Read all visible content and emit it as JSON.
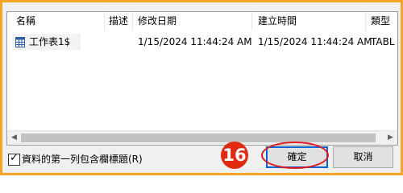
{
  "columns": [
    "名稱",
    "描述",
    "修改日期",
    "建立時間",
    "類型"
  ],
  "rows": [
    {
      "icon": "table-icon",
      "name": "工作表1$",
      "description": "",
      "modified": "1/15/2024 11:44:24 AM",
      "created": "1/15/2024 11:44:24 AM",
      "type": "TABL"
    }
  ],
  "checkbox": {
    "label": "資料的第一列包含欄標題(R)",
    "checked": true
  },
  "buttons": {
    "ok": "確定",
    "cancel": "取消"
  },
  "step_marker": "16",
  "colors": {
    "frame": "#f5a523",
    "marker": "#e02b12",
    "highlight": "#e0181c",
    "focus": "#0a64d6"
  }
}
